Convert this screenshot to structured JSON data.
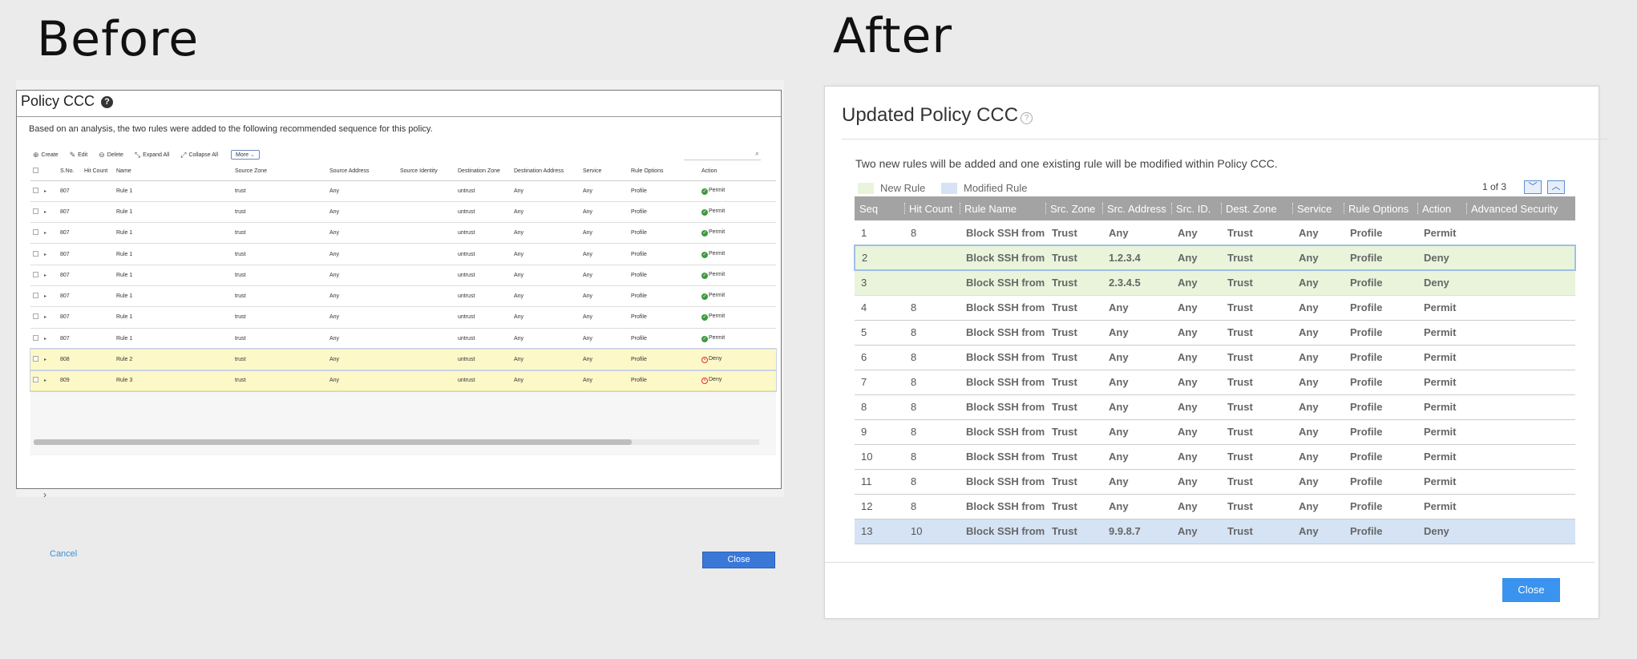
{
  "headings": {
    "before": "Before",
    "after": "After"
  },
  "before": {
    "title": "Policy CCC",
    "help": "?",
    "description": "Based on an analysis, the two rules were added to the following recommended sequence for this policy.",
    "toolbar": {
      "create": "Create",
      "edit": "Edit",
      "delete": "Delete",
      "expand_all": "Expand All",
      "collapse_all": "Collapse All",
      "more": "More"
    },
    "columns": [
      "S.No.",
      "Hit Count",
      "Name",
      "Source Zone",
      "Source Address",
      "Source Identity",
      "Destination Zone",
      "Destination Address",
      "Service",
      "Rule Options",
      "Action"
    ],
    "rows": [
      {
        "sno": "807",
        "name": "Rule 1",
        "src_zone": "trust",
        "src_addr": "Any",
        "dst_zone": "untrust",
        "dst_addr": "Any",
        "service": "Any",
        "options": "Profile",
        "action": "Permit",
        "highlight": false
      },
      {
        "sno": "807",
        "name": "Rule 1",
        "src_zone": "trust",
        "src_addr": "Any",
        "dst_zone": "untrust",
        "dst_addr": "Any",
        "service": "Any",
        "options": "Profile",
        "action": "Permit",
        "highlight": false
      },
      {
        "sno": "807",
        "name": "Rule 1",
        "src_zone": "trust",
        "src_addr": "Any",
        "dst_zone": "untrust",
        "dst_addr": "Any",
        "service": "Any",
        "options": "Profile",
        "action": "Permit",
        "highlight": false
      },
      {
        "sno": "807",
        "name": "Rule 1",
        "src_zone": "trust",
        "src_addr": "Any",
        "dst_zone": "untrust",
        "dst_addr": "Any",
        "service": "Any",
        "options": "Profile",
        "action": "Permit",
        "highlight": false
      },
      {
        "sno": "807",
        "name": "Rule 1",
        "src_zone": "trust",
        "src_addr": "Any",
        "dst_zone": "untrust",
        "dst_addr": "Any",
        "service": "Any",
        "options": "Profile",
        "action": "Permit",
        "highlight": false
      },
      {
        "sno": "807",
        "name": "Rule 1",
        "src_zone": "trust",
        "src_addr": "Any",
        "dst_zone": "untrust",
        "dst_addr": "Any",
        "service": "Any",
        "options": "Profile",
        "action": "Permit",
        "highlight": false
      },
      {
        "sno": "807",
        "name": "Rule 1",
        "src_zone": "trust",
        "src_addr": "Any",
        "dst_zone": "untrust",
        "dst_addr": "Any",
        "service": "Any",
        "options": "Profile",
        "action": "Permit",
        "highlight": false
      },
      {
        "sno": "807",
        "name": "Rule 1",
        "src_zone": "trust",
        "src_addr": "Any",
        "dst_zone": "untrust",
        "dst_addr": "Any",
        "service": "Any",
        "options": "Profile",
        "action": "Permit",
        "highlight": false
      },
      {
        "sno": "808",
        "name": "Rule 2",
        "src_zone": "trust",
        "src_addr": "Any",
        "dst_zone": "untrust",
        "dst_addr": "Any",
        "service": "Any",
        "options": "Profile",
        "action": "Deny",
        "highlight": true
      },
      {
        "sno": "809",
        "name": "Rule 3",
        "src_zone": "trust",
        "src_addr": "Any",
        "dst_zone": "untrust",
        "dst_addr": "Any",
        "service": "Any",
        "options": "Profile",
        "action": "Deny",
        "highlight": true
      }
    ],
    "cancel": "Cancel",
    "close": "Close"
  },
  "after": {
    "title": "Updated Policy CCC",
    "help": "?",
    "description": "Two new rules will be added and one existing rule will be modified within Policy CCC.",
    "legend": {
      "new_rule": "New Rule",
      "modified_rule": "Modified Rule"
    },
    "pager": "1 of 3",
    "columns": [
      "Seq",
      "Hit Count",
      "Rule Name",
      "Src. Zone",
      "Src. Address",
      "Src. ID.",
      "Dest. Zone",
      "Service",
      "Rule Options",
      "Action",
      "Advanced Security"
    ],
    "rows": [
      {
        "seq": "1",
        "hit": "8",
        "name": "Block SSH from...",
        "src_zone": "Trust",
        "src_addr": "Any",
        "src_id": "Any",
        "dst_zone": "Trust",
        "service": "Any",
        "options": "Profile",
        "action": "Permit",
        "kind": "normal"
      },
      {
        "seq": "2",
        "hit": "",
        "name": "Block SSH from...",
        "src_zone": "Trust",
        "src_addr": "1.2.3.4",
        "src_id": "Any",
        "dst_zone": "Trust",
        "service": "Any",
        "options": "Profile",
        "action": "Deny",
        "kind": "new-selected"
      },
      {
        "seq": "3",
        "hit": "",
        "name": "Block SSH from...",
        "src_zone": "Trust",
        "src_addr": "2.3.4.5",
        "src_id": "Any",
        "dst_zone": "Trust",
        "service": "Any",
        "options": "Profile",
        "action": "Deny",
        "kind": "new"
      },
      {
        "seq": "4",
        "hit": "8",
        "name": "Block SSH from...",
        "src_zone": "Trust",
        "src_addr": "Any",
        "src_id": "Any",
        "dst_zone": "Trust",
        "service": "Any",
        "options": "Profile",
        "action": "Permit",
        "kind": "normal"
      },
      {
        "seq": "5",
        "hit": "8",
        "name": "Block SSH from...",
        "src_zone": "Trust",
        "src_addr": "Any",
        "src_id": "Any",
        "dst_zone": "Trust",
        "service": "Any",
        "options": "Profile",
        "action": "Permit",
        "kind": "normal"
      },
      {
        "seq": "6",
        "hit": "8",
        "name": "Block SSH from...",
        "src_zone": "Trust",
        "src_addr": "Any",
        "src_id": "Any",
        "dst_zone": "Trust",
        "service": "Any",
        "options": "Profile",
        "action": "Permit",
        "kind": "normal"
      },
      {
        "seq": "7",
        "hit": "8",
        "name": "Block SSH from...",
        "src_zone": "Trust",
        "src_addr": "Any",
        "src_id": "Any",
        "dst_zone": "Trust",
        "service": "Any",
        "options": "Profile",
        "action": "Permit",
        "kind": "normal"
      },
      {
        "seq": "8",
        "hit": "8",
        "name": "Block SSH from...",
        "src_zone": "Trust",
        "src_addr": "Any",
        "src_id": "Any",
        "dst_zone": "Trust",
        "service": "Any",
        "options": "Profile",
        "action": "Permit",
        "kind": "normal"
      },
      {
        "seq": "9",
        "hit": "8",
        "name": "Block SSH from...",
        "src_zone": "Trust",
        "src_addr": "Any",
        "src_id": "Any",
        "dst_zone": "Trust",
        "service": "Any",
        "options": "Profile",
        "action": "Permit",
        "kind": "normal"
      },
      {
        "seq": "10",
        "hit": "8",
        "name": "Block SSH from...",
        "src_zone": "Trust",
        "src_addr": "Any",
        "src_id": "Any",
        "dst_zone": "Trust",
        "service": "Any",
        "options": "Profile",
        "action": "Permit",
        "kind": "normal"
      },
      {
        "seq": "11",
        "hit": "8",
        "name": "Block SSH from...",
        "src_zone": "Trust",
        "src_addr": "Any",
        "src_id": "Any",
        "dst_zone": "Trust",
        "service": "Any",
        "options": "Profile",
        "action": "Permit",
        "kind": "normal"
      },
      {
        "seq": "12",
        "hit": "8",
        "name": "Block SSH from...",
        "src_zone": "Trust",
        "src_addr": "Any",
        "src_id": "Any",
        "dst_zone": "Trust",
        "service": "Any",
        "options": "Profile",
        "action": "Permit",
        "kind": "normal"
      },
      {
        "seq": "13",
        "hit": "10",
        "name": "Block SSH from...",
        "src_zone": "Trust",
        "src_addr": "9.9.8.7",
        "src_id": "Any",
        "dst_zone": "Trust",
        "service": "Any",
        "options": "Profile",
        "action": "Deny",
        "kind": "modified"
      }
    ],
    "close": "Close"
  },
  "colors": {
    "new_rule": "#e9f4db",
    "modified_rule": "#d5e3f5",
    "before_highlight": "#fdf8c8",
    "primary_button": "#3a93ef",
    "header_bg": "#a3a3a3",
    "link": "#3a8de0"
  },
  "icons": {
    "help": "help-icon",
    "create": "plus-circle-icon",
    "edit": "pencil-icon",
    "delete": "minus-circle-icon",
    "expand": "expand-icon",
    "collapse": "collapse-icon",
    "search": "search-icon",
    "permit": "check-circle-icon",
    "deny": "x-circle-icon",
    "page_down": "chevron-down-icon",
    "page_up": "chevron-up-icon"
  }
}
